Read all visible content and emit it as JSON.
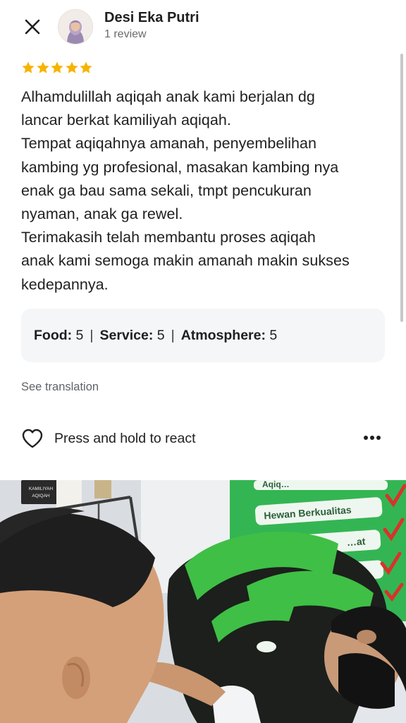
{
  "reviewer": {
    "name": "Desi Eka Putri",
    "review_count": "1 review"
  },
  "rating": {
    "stars": 5,
    "max_stars": 5,
    "color": "#f6b400"
  },
  "review": {
    "text": "Alhamdulillah aqiqah anak kami berjalan dg\nlancar berkat kamiliyah aqiqah.\nTempat aqiqahnya amanah, penyembelihan\nkambing yg profesional, masakan kambing nya\nenak ga bau sama sekali, tmpt pencukuran\nnyaman, anak ga rewel.\nTerimakasih telah membantu proses aqiqah\nanak kami semoga makin amanah makin sukses\nkedepannya."
  },
  "sub_ratings": [
    {
      "label": "Food:",
      "value": "5"
    },
    {
      "label": "Service:",
      "value": "5"
    },
    {
      "label": "Atmosphere:",
      "value": "5"
    }
  ],
  "sub_rating_separator": "|",
  "translation": {
    "label": "See translation"
  },
  "reaction": {
    "label": "Press and hold to react"
  },
  "photo": {
    "sign_lines": [
      "Aqiq…",
      "Hewan Berkualitas",
      "…at"
    ],
    "board_text": "KAMILIYAH\nAQIQAH",
    "colors": {
      "banner_green": "#2fae4e",
      "check_red": "#d9322b",
      "shirt_green": "#3fbf45",
      "shirt_black": "#1c1f1c"
    }
  },
  "icons": {
    "close": "close-icon",
    "heart": "heart-outline-icon",
    "more": "more-horizontal-icon",
    "star": "star-icon"
  }
}
